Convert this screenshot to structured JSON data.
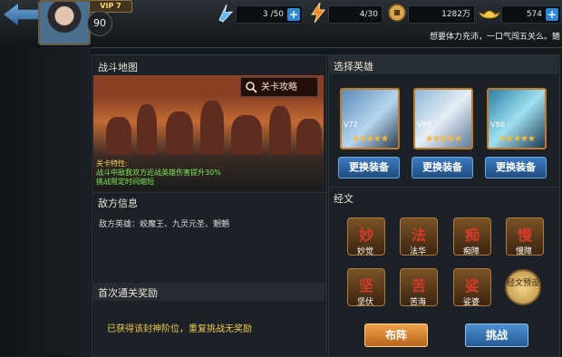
{
  "header": {
    "vip": "VIP 7",
    "level": "90",
    "stamina": "3 /50",
    "stamina_icon": "stamina-icon",
    "energy": "4/30",
    "energy_icon": "lightning-icon",
    "coins": "1282万",
    "coin_icon": "coin-icon",
    "gold": "574",
    "gold_icon": "gold-ingot-icon",
    "marquee": "想要体力充沛，一口气闯五关么。鳍"
  },
  "battle_map": {
    "title": "战斗地图",
    "strategy_button": "关卡攻略",
    "features_heading": "关卡特性:",
    "features": [
      "战斗中敌我双方近战英雄伤害提升30%",
      "挑战限定时间缩短"
    ]
  },
  "enemy_info": {
    "title": "敌方信息",
    "text": "敌方英雄：蛟魔王、九灵元圣、魍魉"
  },
  "first_reward": {
    "title": "首次通关奖励",
    "text": "已获得该封神阶位，重复挑战无奖励"
  },
  "select_hero": {
    "title": "选择英雄",
    "heroes": [
      {
        "level": "V72",
        "stars": "★★★★★",
        "equip": "更换装备"
      },
      {
        "level": "V89",
        "stars": "★★★★★",
        "equip": "更换装备"
      },
      {
        "level": "V86",
        "stars": "★★★★★",
        "equip": "更换装备"
      }
    ]
  },
  "scriptures": {
    "title": "经文",
    "items": [
      {
        "glyph": "妙",
        "label": "妙觉"
      },
      {
        "glyph": "法",
        "label": "法华"
      },
      {
        "glyph": "痴",
        "label": "痴障"
      },
      {
        "glyph": "慢",
        "label": "慢障"
      },
      {
        "glyph": "坚",
        "label": "坚伏"
      },
      {
        "glyph": "苦",
        "label": "苦海"
      },
      {
        "glyph": "娑",
        "label": "娑婆"
      }
    ],
    "preset": "经文预设"
  },
  "actions": {
    "formation": "布阵",
    "challenge": "挑战"
  }
}
